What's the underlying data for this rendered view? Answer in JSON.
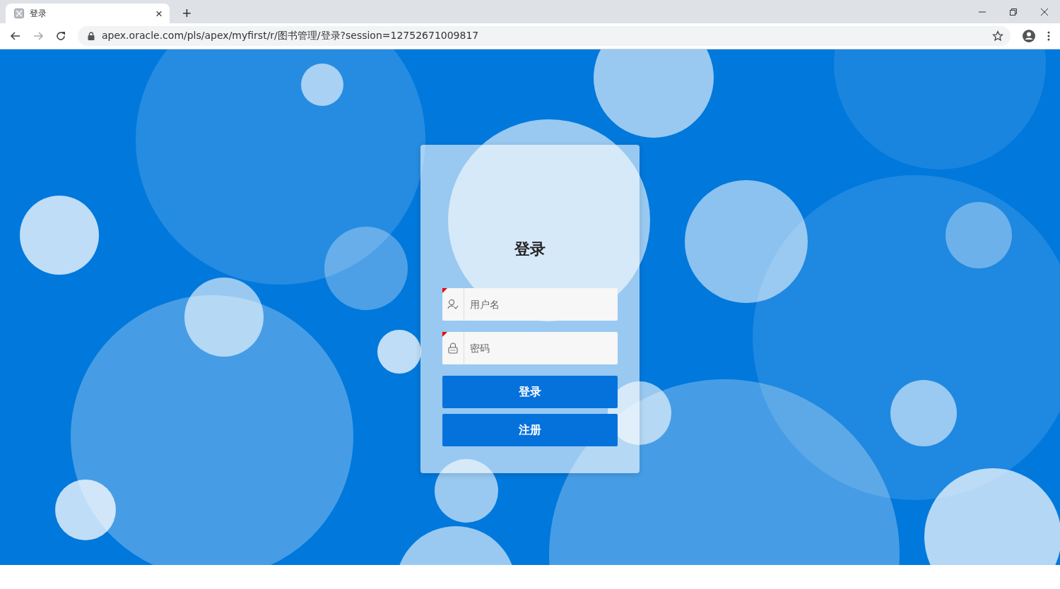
{
  "browser": {
    "tab": {
      "title": "登录",
      "close": "×",
      "new_tab": "+"
    },
    "address": "apex.oracle.com/pls/apex/myfirst/r/图书管理/登录?session=12752671009817"
  },
  "login": {
    "title": "登录",
    "fields": [
      {
        "kind": "user",
        "placeholder": "用户名",
        "required": true
      },
      {
        "kind": "password",
        "placeholder": "密码",
        "required": true
      }
    ],
    "buttons": [
      "登录",
      "注册"
    ]
  }
}
